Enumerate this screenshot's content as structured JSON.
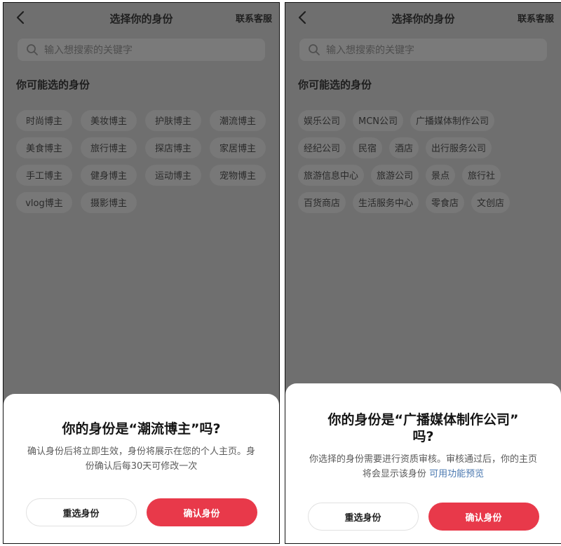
{
  "left": {
    "nav": {
      "title": "选择你的身份",
      "action": "联系客服"
    },
    "search": {
      "placeholder": "输入想搜索的关键字"
    },
    "section_title": "你可能选的身份",
    "tag_rows": [
      [
        "时尚博主",
        "美妆博主",
        "护肤博主",
        "潮流博主"
      ],
      [
        "美食博主",
        "旅行博主",
        "探店博主",
        "家居博主"
      ],
      [
        "手工博主",
        "健身博主",
        "运动博主",
        "宠物博主"
      ],
      [
        "vlog博主",
        "摄影博主"
      ]
    ],
    "sheet": {
      "title": "你的身份是“潮流博主”吗?",
      "body": "确认身份后将立即生效，身份将展示在您的个人主页。身份确认后每30天可修改一次",
      "reselect": "重选身份",
      "confirm": "确认身份"
    }
  },
  "right": {
    "nav": {
      "title": "选择你的身份",
      "action": "联系客服"
    },
    "search": {
      "placeholder": "输入想搜索的关键字"
    },
    "section_title": "你可能选的身份",
    "tag_rows": [
      [
        "娱乐公司",
        "MCN公司",
        "广播媒体制作公司"
      ],
      [
        "经纪公司",
        "民宿",
        "酒店",
        "出行服务公司"
      ],
      [
        "旅游信息中心",
        "旅游公司",
        "景点",
        "旅行社"
      ],
      [
        "百货商店",
        "生活服务中心",
        "零食店",
        "文创店"
      ]
    ],
    "sheet": {
      "title_line1": "你的身份是“广播媒体制作公司”",
      "title_line2": "吗?",
      "body": "你选择的身份需要进行资质审核。审核通过后，你的主页将会显示该身份",
      "link": "可用功能预览",
      "reselect": "重选身份",
      "confirm": "确认身份"
    }
  },
  "colors": {
    "overlay": "#6f6f6f",
    "primary_button": "#e8394a",
    "link": "#4a78b0"
  },
  "icons": [
    "back-icon",
    "search-icon"
  ]
}
